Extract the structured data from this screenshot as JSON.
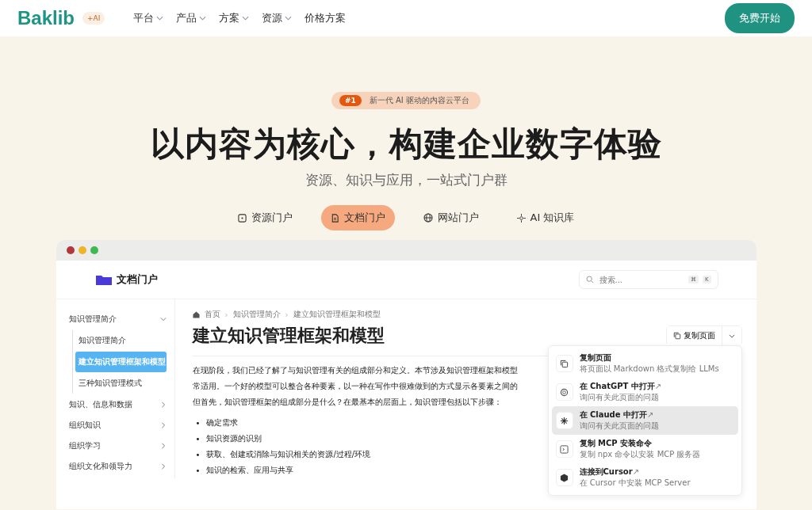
{
  "header": {
    "logo": "Baklib",
    "logo_badge": "+AI",
    "nav": [
      {
        "label": "平台",
        "has_menu": true
      },
      {
        "label": "产品",
        "has_menu": true
      },
      {
        "label": "方案",
        "has_menu": true
      },
      {
        "label": "资源",
        "has_menu": true
      },
      {
        "label": "价格方案",
        "has_menu": false
      }
    ],
    "cta": "免费开始"
  },
  "hero": {
    "badge_rank": "#1",
    "badge_text": "新一代 AI 驱动的内容云平台",
    "title": "以内容为核心，构建企业数字体验",
    "subtitle": "资源、知识与应用，一站式门户群",
    "tabs": [
      {
        "label": "资源门户",
        "kind": "square",
        "selected": false
      },
      {
        "label": "文档门户",
        "kind": "doc",
        "selected": true
      },
      {
        "label": "网站门户",
        "kind": "globe",
        "selected": false
      },
      {
        "label": "AI 知识库",
        "kind": "spark",
        "selected": false
      }
    ]
  },
  "preview": {
    "site_title": "文档门户",
    "search": {
      "placeholder": "搜索...",
      "keys": [
        "⌘",
        "K"
      ]
    },
    "sidebar": [
      {
        "label": "知识管理简介",
        "expanded": true,
        "children": [
          {
            "label": "知识管理简介",
            "selected": false
          },
          {
            "label": "建立知识管理框架和模型",
            "selected": true
          },
          {
            "label": "三种知识管理模式",
            "selected": false
          }
        ]
      },
      {
        "label": "知识、信息和数据",
        "expanded": false
      },
      {
        "label": "组织知识",
        "expanded": false
      },
      {
        "label": "组织学习",
        "expanded": false
      },
      {
        "label": "组织文化和领导力",
        "expanded": false
      }
    ],
    "breadcrumb": [
      {
        "label": "首页"
      },
      {
        "label": "知识管理简介",
        "separator": "›"
      },
      {
        "label": "建立知识管理框架和模型",
        "separator": "›"
      }
    ],
    "page_title": "建立知识管理框架和模型",
    "copy_button": "复制页面",
    "paragraph": [
      "在现阶段，我们已经了解了与知识管理有关的组成部分和定义。本节涉及知识管理框架和模型",
      "常适用。一个好的模型可以整合各种要素，以一种在写作中很难做到的方式显示各要素之间的",
      "但首先，知识管理框架的组成部分是什么？在最基本的层面上，知识管理包括以下步骤："
    ],
    "bullets": [
      {
        "marker": "•",
        "text": "确定需求"
      },
      {
        "marker": "•",
        "text": "知识资源的识别"
      },
      {
        "marker": "•",
        "text": "获取、创建或消除与知识相关的资源/过程/环境"
      },
      {
        "marker": "•",
        "text": "知识的检索、应用与共享"
      }
    ],
    "menu": [
      {
        "kind": "copy",
        "title": "复制页面",
        "subtitle": "将页面以 Markdown 格式复制给 LLMs",
        "selected": false
      },
      {
        "kind": "chatgpt",
        "title": "在 ChatGPT 中打开",
        "arrow": "↗",
        "subtitle": "询问有关此页面的问题",
        "selected": false
      },
      {
        "kind": "claude",
        "title": "在 Claude 中打开",
        "arrow": "↗",
        "subtitle": "询问有关此页面的问题",
        "selected": true
      },
      {
        "kind": "terminal",
        "title": "复制 MCP 安装命令",
        "subtitle": "复制 npx 命令以安装 MCP 服务器",
        "selected": false
      },
      {
        "kind": "cube",
        "title": "连接到Cursor",
        "arrow": "↗",
        "subtitle": "在 Cursor 中安装 MCP Server",
        "selected": false
      }
    ]
  }
}
